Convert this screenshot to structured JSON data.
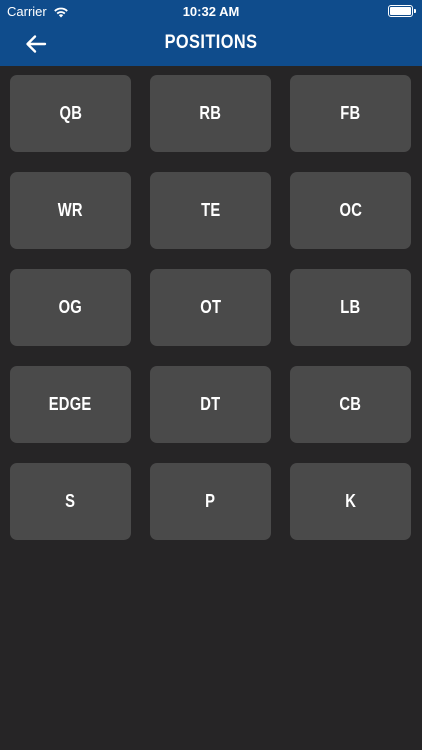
{
  "status_bar": {
    "carrier": "Carrier",
    "time": "10:32 AM"
  },
  "nav": {
    "title": "POSITIONS",
    "back_icon": "arrow-left-icon"
  },
  "positions": [
    "QB",
    "RB",
    "FB",
    "WR",
    "TE",
    "OC",
    "OG",
    "OT",
    "LB",
    "EDGE",
    "DT",
    "CB",
    "S",
    "P",
    "K"
  ],
  "colors": {
    "header": "#0f4c8c",
    "background": "#262526",
    "button": "#4a4a4a",
    "text": "#ffffff"
  }
}
